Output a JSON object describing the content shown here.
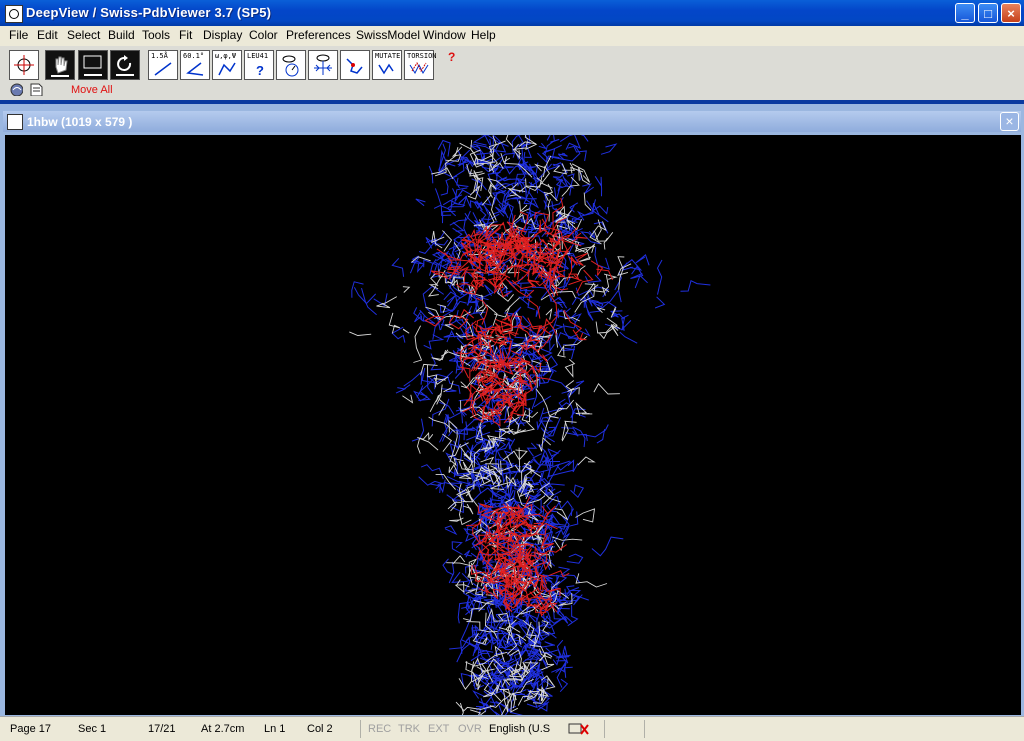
{
  "window": {
    "title": "DeepView / Swiss-PdbViewer 3.7 (SP5)"
  },
  "menu": [
    "File",
    "Edit",
    "Select",
    "Build",
    "Tools",
    "Fit",
    "Display",
    "Color",
    "Preferences",
    "SwissModel",
    "Window",
    "Help"
  ],
  "toolbar": {
    "tools": [
      {
        "name": "center-molecule-tool",
        "label": ""
      },
      {
        "name": "move-hand-tool",
        "label": ""
      },
      {
        "name": "zoom-tool",
        "label": ""
      },
      {
        "name": "rotate-tool",
        "label": ""
      },
      {
        "name": "measure-distance-tool",
        "label": "1.5Å"
      },
      {
        "name": "measure-angle-tool",
        "label": "60.1°"
      },
      {
        "name": "measure-dihedral-tool",
        "label": "ω,φ,Ψ"
      },
      {
        "name": "identify-group-tool",
        "label": "LEU41"
      },
      {
        "name": "show-neighbors-tool",
        "label": ""
      },
      {
        "name": "center-atom-tool",
        "label": ""
      },
      {
        "name": "fix-atom-tool",
        "label": ""
      },
      {
        "name": "mutate-tool",
        "label": "MUTATE"
      },
      {
        "name": "torsion-tool",
        "label": "TORSION"
      }
    ],
    "help": "?",
    "mode_text": "Move All"
  },
  "document": {
    "title": "1hbw  (1019 x 579 )",
    "close": "×"
  },
  "colors": {
    "backbone": "#2030e0",
    "highlight": "#e02020",
    "sidechain": "#d8d8d8"
  },
  "status": {
    "page": "Page  17",
    "sec": "Sec  1",
    "pages": "17/21",
    "at": "At  2.7cm",
    "ln": "Ln  1",
    "col": "Col  2",
    "rec": "REC",
    "trk": "TRK",
    "ext": "EXT",
    "ovr": "OVR",
    "lang": "English (U.S"
  }
}
